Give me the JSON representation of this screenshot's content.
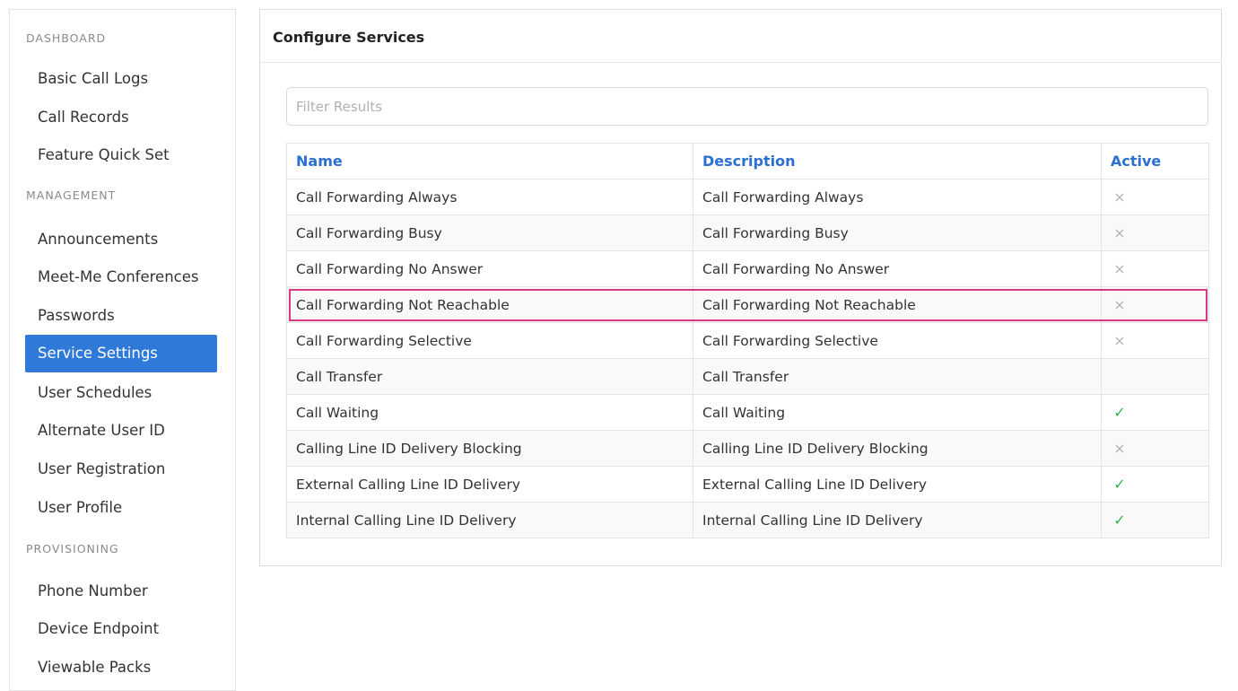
{
  "sidebar": {
    "dashboard_header": "DASHBOARD",
    "management_header": "MANAGEMENT",
    "provisioning_header": "PROVISIONING",
    "dashboard_items": [
      {
        "label": "Basic Call Logs"
      },
      {
        "label": "Call Records"
      },
      {
        "label": "Feature Quick Set"
      }
    ],
    "management_items": [
      {
        "label": "Announcements"
      },
      {
        "label": "Meet-Me Conferences"
      },
      {
        "label": "Passwords"
      },
      {
        "label": "Service Settings",
        "active": true
      },
      {
        "label": "User Schedules"
      },
      {
        "label": "Alternate User ID"
      },
      {
        "label": "User Registration"
      },
      {
        "label": "User Profile"
      }
    ],
    "provisioning_items": [
      {
        "label": "Phone Number"
      },
      {
        "label": "Device Endpoint"
      },
      {
        "label": "Viewable Packs"
      }
    ]
  },
  "main": {
    "title": "Configure Services",
    "filter_placeholder": "Filter Results",
    "filter_value": "",
    "columns": {
      "name": "Name",
      "description": "Description",
      "active": "Active"
    },
    "rows": [
      {
        "name": "Call Forwarding Always",
        "description": "Call Forwarding Always",
        "active": "x"
      },
      {
        "name": "Call Forwarding Busy",
        "description": "Call Forwarding Busy",
        "active": "x"
      },
      {
        "name": "Call Forwarding No Answer",
        "description": "Call Forwarding No Answer",
        "active": "x"
      },
      {
        "name": "Call Forwarding Not Reachable",
        "description": "Call Forwarding Not Reachable",
        "active": "x",
        "highlighted": true
      },
      {
        "name": "Call Forwarding Selective",
        "description": "Call Forwarding Selective",
        "active": "x"
      },
      {
        "name": "Call Transfer",
        "description": "Call Transfer",
        "active": ""
      },
      {
        "name": "Call Waiting",
        "description": "Call Waiting",
        "active": "check"
      },
      {
        "name": "Calling Line ID Delivery Blocking",
        "description": "Calling Line ID Delivery Blocking",
        "active": "x"
      },
      {
        "name": "External Calling Line ID Delivery",
        "description": "External Calling Line ID Delivery",
        "active": "check"
      },
      {
        "name": "Internal Calling Line ID Delivery",
        "description": "Internal Calling Line ID Delivery",
        "active": "check"
      }
    ]
  },
  "colors": {
    "accent": "#2f7ad8",
    "header_text": "#2b6fd1",
    "check": "#2bb24c",
    "x_mark": "#b5b5b5",
    "highlight": "#d63a82"
  },
  "icons": {
    "x": "close-icon",
    "check": "check-icon"
  }
}
